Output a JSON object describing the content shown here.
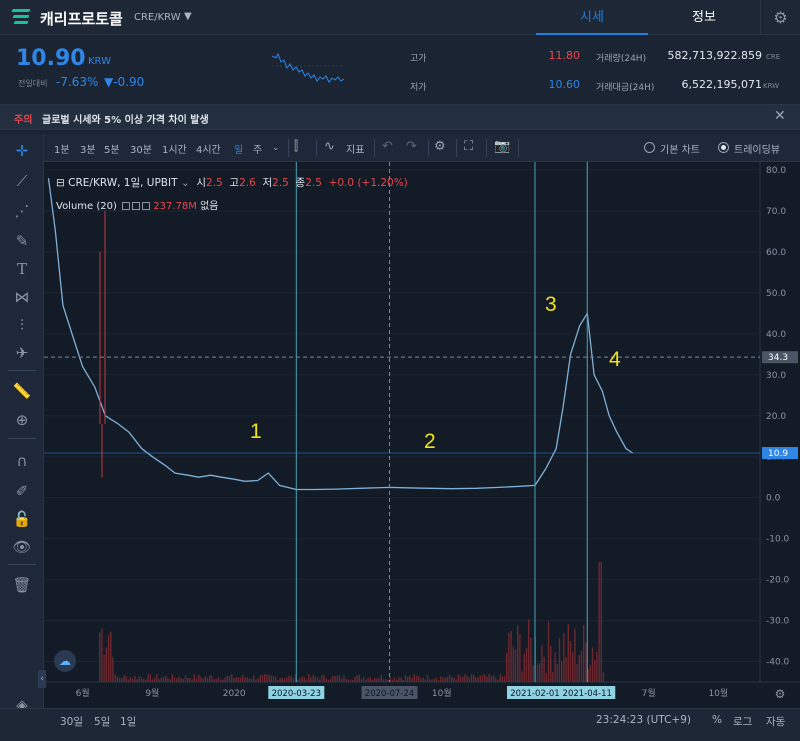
{
  "header": {
    "coin_name": "캐리프로토콜",
    "pair": "CRE/KRW",
    "tabs": [
      {
        "label": "시세",
        "active": true
      },
      {
        "label": "정보",
        "active": false
      }
    ],
    "accent_color": "#1d7fde"
  },
  "price": {
    "current": "10.90",
    "unit": "KRW",
    "prev_day_label": "전일대비",
    "change_pct": "-7.63%",
    "change_abs": "▼-0.90",
    "high_label": "고가",
    "high": "11.80",
    "low_label": "저가",
    "low": "10.60",
    "volume_label": "거래량(24H)",
    "volume": "582,713,922.859",
    "volume_unit": "CRE",
    "value_label": "거래대금(24H)",
    "value": "6,522,195,071",
    "value_unit": "KRW"
  },
  "notice": {
    "tag": "주의",
    "text": "글로벌 시세와 5% 이상 가격 차이 발생"
  },
  "toolbar": {
    "timeframes": [
      "1분",
      "3분",
      "5분",
      "30분",
      "1시간",
      "4시간",
      "일",
      "주"
    ],
    "active_timeframe": "일",
    "indicators_label": "지표",
    "basic_chart_label": "기본 차트",
    "tradingview_label": "트레이딩뷰",
    "selected_view": "트레이딩뷰"
  },
  "legend": {
    "symbol": "CRE/KRW, 1일, UPBIT",
    "open_k": "시",
    "open_v": "2.5",
    "high_k": "고",
    "high_v": "2.6",
    "low_k": "저",
    "low_v": "2.5",
    "close_k": "종",
    "close_v": "2.5",
    "change": "+0.0 (+1.20%)",
    "volume_label": "Volume (20)",
    "volume_value": "237.78M",
    "volume_extra": "없음"
  },
  "annotations": [
    "1",
    "2",
    "3",
    "4"
  ],
  "chart_data": {
    "type": "line",
    "title": "",
    "xlabel": "",
    "ylabel": "",
    "ylim": [
      -45,
      80
    ],
    "y_ticks": [
      "80.0",
      "70.0",
      "60.0",
      "50.0",
      "40.0",
      "30.0",
      "20.0",
      "10.0",
      "0.0",
      "-10.0",
      "-20.0",
      "-30.0",
      "-40.0"
    ],
    "x_ticks": [
      "6월",
      "9월",
      "2020",
      "10월",
      "7월",
      "10월"
    ],
    "price_labels": {
      "crosshair": "34.3",
      "last": "10.9"
    },
    "date_markers": [
      "2020-03-23",
      "2020-07-24",
      "2021-02-01",
      "2021-04-11"
    ],
    "series": [
      {
        "x": [
          "2019-05-01",
          "2019-05-10",
          "2019-05-20",
          "2019-06-01",
          "2019-06-15",
          "2019-07-01",
          "2019-07-15",
          "2019-08-01",
          "2019-08-15",
          "2019-09-01",
          "2019-09-15",
          "2019-10-01",
          "2019-10-15",
          "2019-11-01",
          "2019-11-15",
          "2019-12-01",
          "2019-12-15",
          "2020-01-01",
          "2020-01-15",
          "2020-02-01",
          "2020-02-15",
          "2020-03-01",
          "2020-03-23",
          "2020-04-15",
          "2020-05-15",
          "2020-06-15",
          "2020-07-24",
          "2020-08-15",
          "2020-09-15",
          "2020-10-15",
          "2020-11-15",
          "2020-12-15",
          "2021-01-15",
          "2021-02-01",
          "2021-02-15",
          "2021-03-01",
          "2021-03-10",
          "2021-03-20",
          "2021-04-01",
          "2021-04-11",
          "2021-04-20",
          "2021-05-01",
          "2021-05-10",
          "2021-05-20",
          "2021-06-01",
          "2021-06-10"
        ],
        "values": [
          78,
          65,
          47,
          40,
          32,
          27,
          20,
          18,
          16,
          12,
          10,
          8,
          6,
          5.5,
          5,
          5.5,
          5,
          4.5,
          4,
          4.2,
          6,
          3,
          2,
          2,
          2.1,
          2.3,
          2.5,
          2.4,
          2.3,
          2.2,
          2.3,
          2.5,
          2.8,
          3,
          7,
          12,
          22,
          35,
          42,
          45,
          30,
          26,
          20,
          16,
          12,
          10.9
        ],
        "color": "#7fb0d8"
      }
    ],
    "volume_series": {
      "name": "Volume (20)",
      "color": "#b0323a"
    }
  }
}
